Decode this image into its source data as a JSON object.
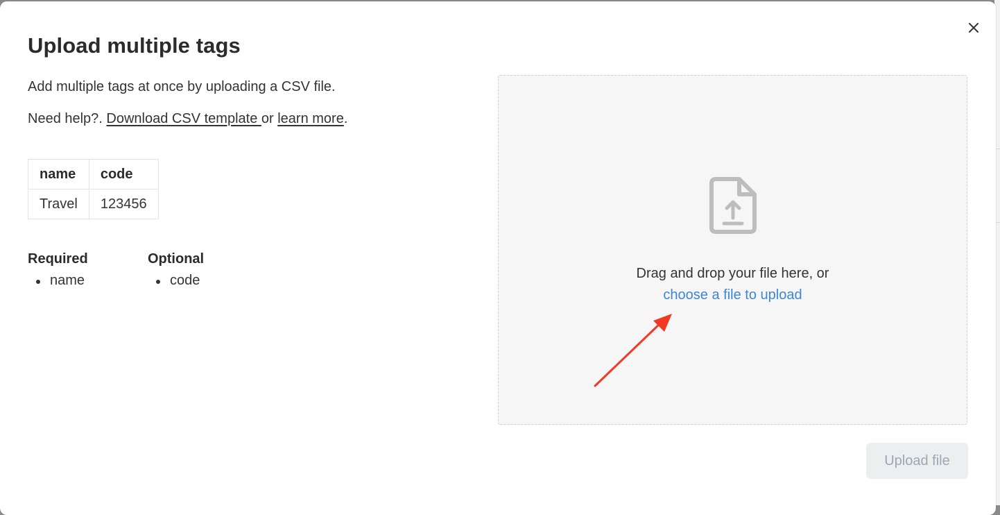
{
  "modal": {
    "title": "Upload multiple tags",
    "description": "Add multiple tags at once by uploading a CSV file.",
    "help": {
      "prefix": "Need help?. ",
      "template_link": "Download CSV template ",
      "separator": "or ",
      "learn_link": "learn more",
      "suffix": "."
    },
    "sample_table": {
      "headers": [
        "name",
        "code"
      ],
      "rows": [
        [
          "Travel",
          "123456"
        ]
      ]
    },
    "required": {
      "heading": "Required",
      "items": [
        "name"
      ]
    },
    "optional": {
      "heading": "Optional",
      "items": [
        "code"
      ]
    },
    "dropzone": {
      "text": "Drag and drop your file here, or",
      "link": "choose a file to upload",
      "icon": "file-upload-icon"
    },
    "upload_button": "Upload file",
    "close_icon": "close-icon"
  },
  "colors": {
    "link": "#3d86d6",
    "annotation_arrow": "#f03a24",
    "disabled_button_bg": "#eceef0",
    "disabled_button_text": "#9aa7b4"
  }
}
